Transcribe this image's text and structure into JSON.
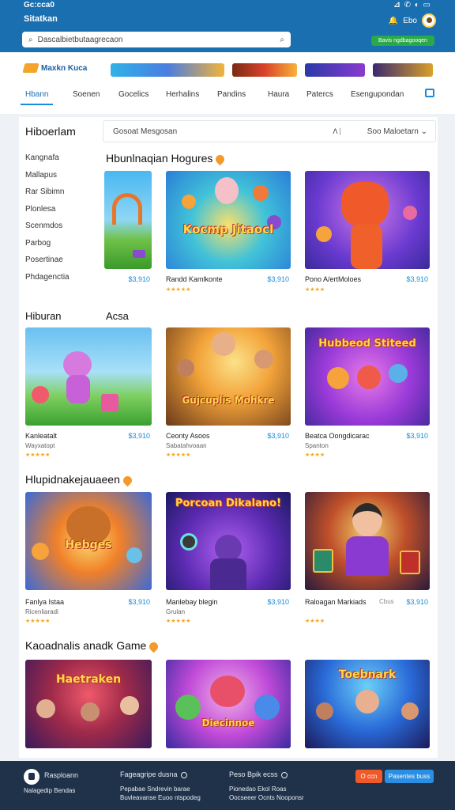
{
  "status_bar": {
    "time": "Gc:cca0",
    "icons": "⊿ ✆ ◐ ▭"
  },
  "header": {
    "app_title": "Sitatkan",
    "search_placeholder": "Dascalbietbutaagrecaon",
    "right_label": "Ebo",
    "green_button": "Bavis ngdbagooqen"
  },
  "brand": {
    "name": "Maxkn Kuca"
  },
  "nav": {
    "tabs": [
      "Hbann",
      "Soenen",
      "Gocelics",
      "Herhalins",
      "Pandins",
      "Haura",
      "Patercs",
      "Esengupondan"
    ]
  },
  "sidebar": {
    "title": "Hiboerlam",
    "items": [
      "Kangnafa",
      "Mallapus",
      "Rar Sibimn",
      "Plonlesa",
      "Scenmdos",
      "Parbog",
      "Posertinae",
      "Phdagenctia"
    ]
  },
  "filter": {
    "placeholder": "Gosoat Mesgosan",
    "sort_label": "Soo Maloetarn"
  },
  "sections": [
    {
      "title": "Hbunlnaqian Hogures",
      "left_label": null,
      "cards": [
        {
          "name": "",
          "price": "$3,910",
          "sub": "",
          "art": "Kocmp Jitaocl"
        },
        {
          "name": "Randd Kamlkonte",
          "price": "$3,910",
          "sub": "",
          "art": ""
        },
        {
          "name": "Pono A/ertMoloes",
          "price": "$3,910",
          "sub": "",
          "art": ""
        }
      ]
    },
    {
      "title": "Acsa",
      "left_label": "Hiburan",
      "cards": [
        {
          "name": "Kanleatalt",
          "price": "$3,910",
          "sub": "Wayxatopt",
          "art": ""
        },
        {
          "name": "Ceonty Asoos",
          "price": "$3,910",
          "sub": "Sabatahvoaan",
          "art": "Gujcuplis Mohkre"
        },
        {
          "name": "Beatca Oongdicarac",
          "price": "$3,910",
          "sub": "Spanton",
          "art": "Hubbeod Stiteed"
        }
      ]
    },
    {
      "title": "Hlupidnakejauaeen",
      "left_label": null,
      "cards": [
        {
          "name": "Fanlya Istaa",
          "price": "$3,910",
          "sub": "Ricenliaradi",
          "art": "Hebges"
        },
        {
          "name": "Manlebay blegin",
          "price": "$3,910",
          "sub": "Grulan",
          "art": "Porcoan Dikalano!"
        },
        {
          "name": "Raloagan Markiads",
          "price": "$3,910",
          "sub": "",
          "extra": "Cbus",
          "art": ""
        }
      ]
    },
    {
      "title": "Kaoadnalis anadk Game",
      "left_label": null,
      "cards": [
        {
          "name": "",
          "price": "",
          "sub": "",
          "art": "Haetraken"
        },
        {
          "name": "",
          "price": "",
          "sub": "",
          "art": "Diecinnoe"
        },
        {
          "name": "",
          "price": "",
          "sub": "",
          "art": "Toebnark"
        }
      ]
    }
  ],
  "footer": {
    "brand": "Rasploann",
    "brand_sub": "Nalagedip Bendas",
    "col1_title": "Fageagripe dusna",
    "col1_lines": [
      "Pepabae Sndrevin barae",
      "Buvleavanse Euoo ntspodeg"
    ],
    "col2_title": "Peso Bpik ecss",
    "col2_lines": [
      "Pionedao Ekol Roas",
      "Oocseeer Ocnts Nooponsr"
    ],
    "btn1": "O ccn",
    "btn2": "Pasentes buss"
  }
}
